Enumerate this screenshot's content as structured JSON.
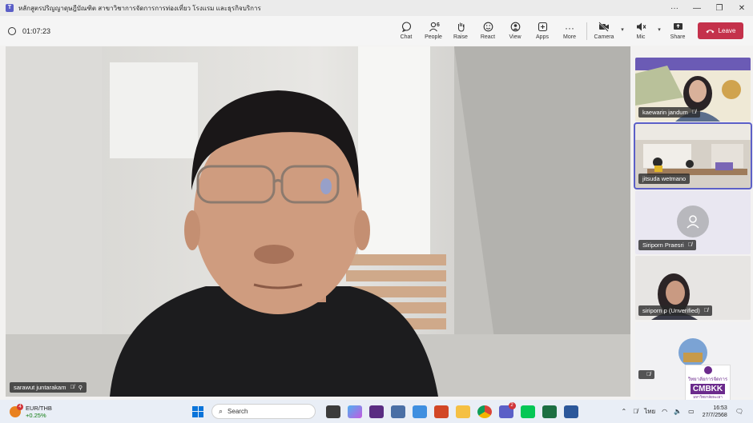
{
  "window": {
    "title": "หลักสูตรปริญญาดุษฎีบัณฑิต สาขาวิชาการจัดการการท่องเที่ยว โรงแรม และธุรกิจบริการ",
    "controls": {
      "more": "···",
      "minimize": "—",
      "restore": "❐",
      "close": "✕"
    }
  },
  "meeting": {
    "timer": "01:07:23",
    "toolbar": {
      "chat": "Chat",
      "people": "People",
      "people_count": "6",
      "raise": "Raise",
      "react": "React",
      "view": "View",
      "apps": "Apps",
      "more": "More",
      "camera": "Camera",
      "mic": "Mic",
      "share": "Share",
      "leave": "Leave"
    }
  },
  "main_speaker": {
    "name": "sarawut juntarakam"
  },
  "participants": [
    {
      "name": "kaewarin jandum"
    },
    {
      "name": "jitsuda wetmano"
    },
    {
      "name": "Siriporn Praesri"
    },
    {
      "name": "siriporn p (Unverified)"
    },
    {
      "name": ""
    }
  ],
  "brand": {
    "line1": "วิทยาลัยการจัดการ",
    "line2": "CMBKK",
    "line3": "มหาวิทยาลัยพะเยา"
  },
  "taskbar": {
    "weather_badge": "4",
    "ticker": "EUR/THB",
    "change": "+0.25%",
    "search_placeholder": "Search",
    "teams_badge": "2",
    "language": "ไทย",
    "time": "16:53",
    "date": "27/7/2568"
  },
  "colors": {
    "accent": "#5b5fc7",
    "leave": "#c4314b"
  }
}
